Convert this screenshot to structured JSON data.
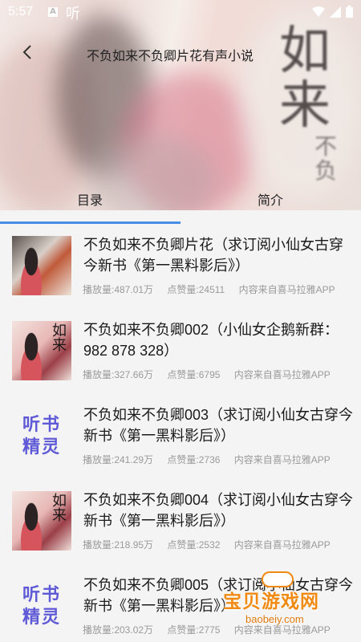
{
  "status_bar": {
    "time": "5:57",
    "listen_glyph": "听"
  },
  "header": {
    "back_icon": "back-arrow-icon",
    "title": "不负如来不负卿片花有声小说"
  },
  "hero": {
    "calligraphy": "如来",
    "calligraphy_small": "不负"
  },
  "tabs": [
    {
      "label": "目录",
      "selected": true
    },
    {
      "label": "简介",
      "selected": false
    }
  ],
  "episodes": [
    {
      "title": "不负如来不负卿片花（求订阅小仙女古穿今新书《第一黑料影后》）",
      "plays": "播放量:487.01万",
      "likes": "点赞量:24511",
      "source": "内容来自喜马拉雅APP",
      "thumb": "cover1"
    },
    {
      "title": "不负如来不负卿002（小仙女企鹅新群：982 878 328）",
      "plays": "播放量:327.66万",
      "likes": "点赞量:6795",
      "source": "内容来自喜马拉雅APP",
      "thumb": "cover"
    },
    {
      "title": "不负如来不负卿003（求订阅小仙女古穿今新书《第一黑料影后》）",
      "plays": "播放量:241.29万",
      "likes": "点赞量:2736",
      "source": "内容来自喜马拉雅APP",
      "thumb": "logo"
    },
    {
      "title": "不负如来不负卿004（求订阅小仙女古穿今新书《第一黑料影后》）",
      "plays": "播放量:218.95万",
      "likes": "点赞量:2532",
      "source": "内容来自喜马拉雅APP",
      "thumb": "cover"
    },
    {
      "title": "不负如来不负卿005（求订阅小仙女古穿今新书《第一黑料影后》）",
      "plays": "播放量:203.02万",
      "likes": "点赞量:2775",
      "source": "内容来自喜马拉雅APP",
      "thumb": "logo"
    }
  ],
  "logo_thumb": {
    "line1": "听书",
    "line2": "精灵"
  },
  "cover_thumb": {
    "text": "如来"
  },
  "watermark": {
    "name": "宝贝游戏网",
    "url": "baobeiy.com"
  },
  "colors": {
    "accent": "#4a8fe6",
    "logo": "#5f5ad6",
    "watermark": "#f08a13"
  }
}
